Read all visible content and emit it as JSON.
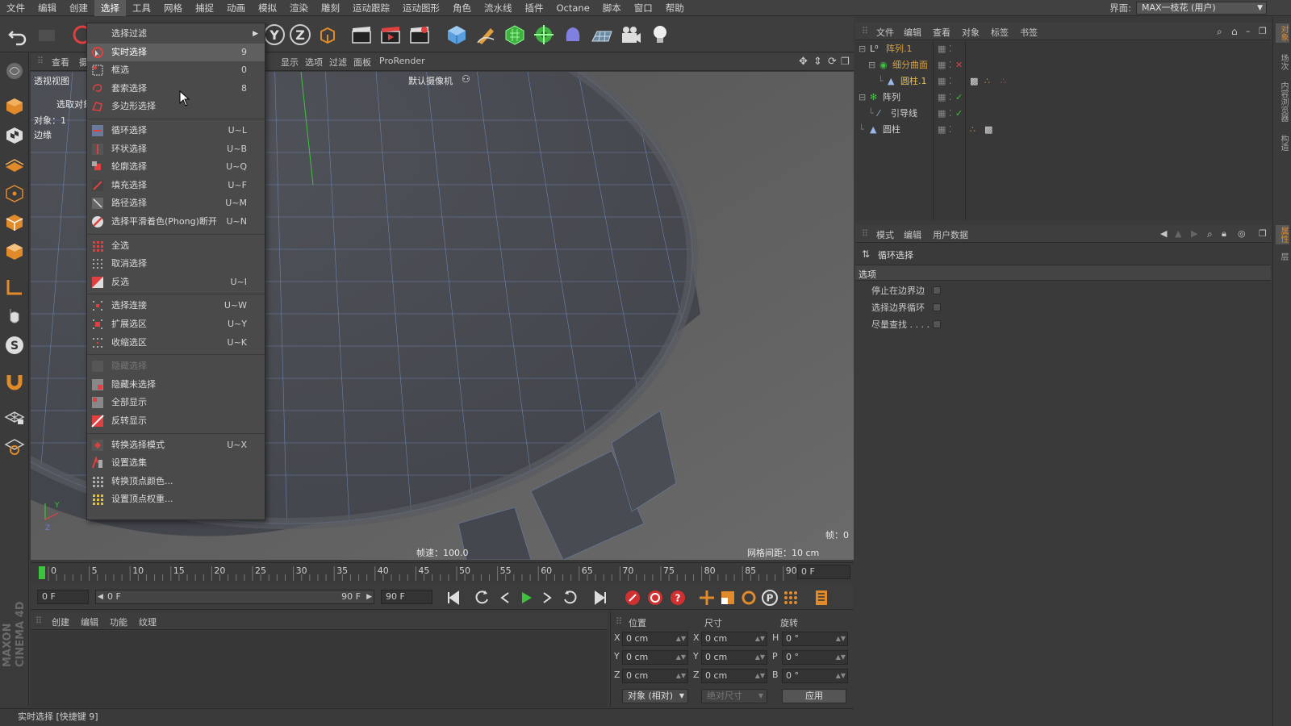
{
  "menubar": {
    "items": [
      "文件",
      "编辑",
      "创建",
      "选择",
      "工具",
      "网格",
      "捕捉",
      "动画",
      "模拟",
      "渲染",
      "雕刻",
      "运动跟踪",
      "运动图形",
      "角色",
      "流水线",
      "插件",
      "Octane",
      "脚本",
      "窗口",
      "帮助"
    ],
    "active_index": 3,
    "layout_label": "界面:",
    "layout_value": "MAX一枝花 (用户)"
  },
  "viewport": {
    "menu": [
      "查看",
      "摄像机",
      "显示",
      "选项",
      "过滤",
      "面板",
      "ProRender"
    ],
    "view_name": "透视视图",
    "camera_label": "默认摄像机",
    "selection_hint": "选取对象",
    "info_line1": "对象：1",
    "info_line2": "边缘",
    "fps": "帧速：100.0",
    "grid_spacing": "网格间距：10 cm",
    "frame_indicator": "帧：0"
  },
  "timeline": {
    "ticks": [
      "0",
      "5",
      "10",
      "15",
      "20",
      "25",
      "30",
      "35",
      "40",
      "45",
      "50",
      "55",
      "60",
      "65",
      "70",
      "75",
      "80",
      "85",
      "90"
    ],
    "current_frame": "0 F"
  },
  "transport": {
    "start_field": "0 F",
    "range_start": "0 F",
    "range_end": "90 F",
    "end_field": "90 F"
  },
  "material_panel": {
    "menu": [
      "创建",
      "编辑",
      "功能",
      "纹理"
    ]
  },
  "coordinates": {
    "headers": {
      "position": "位置",
      "size": "尺寸",
      "rotation": "旋转"
    },
    "rows": [
      {
        "axis": "X",
        "pos": "0 cm",
        "size_axis": "X",
        "size": "0 cm",
        "rot_axis": "H",
        "rot": "0 °"
      },
      {
        "axis": "Y",
        "pos": "0 cm",
        "size_axis": "Y",
        "size": "0 cm",
        "rot_axis": "P",
        "rot": "0 °"
      },
      {
        "axis": "Z",
        "pos": "0 cm",
        "size_axis": "Z",
        "size": "0 cm",
        "rot_axis": "B",
        "rot": "0 °"
      }
    ],
    "mode_select": "对象 (相对)",
    "size_mode_select": "绝对尺寸",
    "apply_button": "应用"
  },
  "status": {
    "text": "实时选择 [快捷键 9]"
  },
  "object_manager": {
    "menu": [
      "文件",
      "编辑",
      "查看",
      "对象",
      "标签",
      "书签"
    ],
    "objects": [
      {
        "name": "阵列.1",
        "indent": 0,
        "color": "#d8a040"
      },
      {
        "name": "细分曲面",
        "indent": 1,
        "color": "#d8a040"
      },
      {
        "name": "圆柱.1",
        "indent": 2,
        "color": "#e8c050"
      },
      {
        "name": "阵列",
        "indent": 0,
        "color": "#d0d0d0"
      },
      {
        "name": "引导线",
        "indent": 1,
        "color": "#d0d0d0"
      },
      {
        "name": "圆柱",
        "indent": 0,
        "color": "#d0d0d0"
      }
    ]
  },
  "attributes": {
    "menu": [
      "模式",
      "编辑",
      "用户数据"
    ],
    "tool_title": "循环选择",
    "section": "选项",
    "options": [
      "停止在边界边",
      "选择边界循环",
      "尽量查找 . . . ."
    ]
  },
  "right_strip": {
    "tabs": [
      "对象",
      "场次",
      "内容浏览器",
      "构造",
      "属性",
      "层"
    ]
  },
  "select_menu": {
    "items": [
      {
        "label": "选择过滤",
        "shortcut": "",
        "submenu": true,
        "icon": "none"
      },
      {
        "label": "实时选择",
        "shortcut": "9",
        "highlight": true,
        "icon": "live-select"
      },
      {
        "label": "框选",
        "shortcut": "0",
        "icon": "rect-select"
      },
      {
        "label": "套索选择",
        "shortcut": "8",
        "icon": "lasso"
      },
      {
        "label": "多边形选择",
        "shortcut": "",
        "icon": "polygon-select"
      },
      {
        "sep": true
      },
      {
        "label": "循环选择",
        "shortcut": "U~L",
        "icon": "loop"
      },
      {
        "label": "环状选择",
        "shortcut": "U~B",
        "icon": "ring"
      },
      {
        "label": "轮廓选择",
        "shortcut": "U~Q",
        "icon": "outline"
      },
      {
        "label": "填充选择",
        "shortcut": "U~F",
        "icon": "fill"
      },
      {
        "label": "路径选择",
        "shortcut": "U~M",
        "icon": "path"
      },
      {
        "label": "选择平滑着色(Phong)断开",
        "shortcut": "U~N",
        "icon": "phong"
      },
      {
        "sep": true
      },
      {
        "label": "全选",
        "shortcut": "",
        "icon": "select-all"
      },
      {
        "label": "取消选择",
        "shortcut": "",
        "icon": "deselect"
      },
      {
        "label": "反选",
        "shortcut": "U~I",
        "icon": "invert"
      },
      {
        "sep": true
      },
      {
        "label": "选择连接",
        "shortcut": "U~W",
        "icon": "connected"
      },
      {
        "label": "扩展选区",
        "shortcut": "U~Y",
        "icon": "grow"
      },
      {
        "label": "收缩选区",
        "shortcut": "U~K",
        "icon": "shrink"
      },
      {
        "sep": true
      },
      {
        "label": "隐藏选择",
        "shortcut": "",
        "disabled": true,
        "icon": "hide-selected"
      },
      {
        "label": "隐藏未选择",
        "shortcut": "",
        "icon": "hide-unselected"
      },
      {
        "label": "全部显示",
        "shortcut": "",
        "icon": "unhide-all"
      },
      {
        "label": "反转显示",
        "shortcut": "",
        "icon": "invert-visibility"
      },
      {
        "sep": true
      },
      {
        "label": "转换选择模式",
        "shortcut": "U~X",
        "icon": "convert-mode"
      },
      {
        "label": "设置选集",
        "shortcut": "",
        "icon": "selection-tag"
      },
      {
        "label": "转换顶点颜色...",
        "shortcut": "",
        "icon": "vertex-color"
      },
      {
        "label": "设置顶点权重...",
        "shortcut": "",
        "icon": "vertex-weight"
      }
    ]
  },
  "colors": {
    "accent_red": "#e04040",
    "accent_green": "#40c040",
    "accent_orange": "#e08a2a",
    "viewport_bg": "#5c5c5c"
  }
}
